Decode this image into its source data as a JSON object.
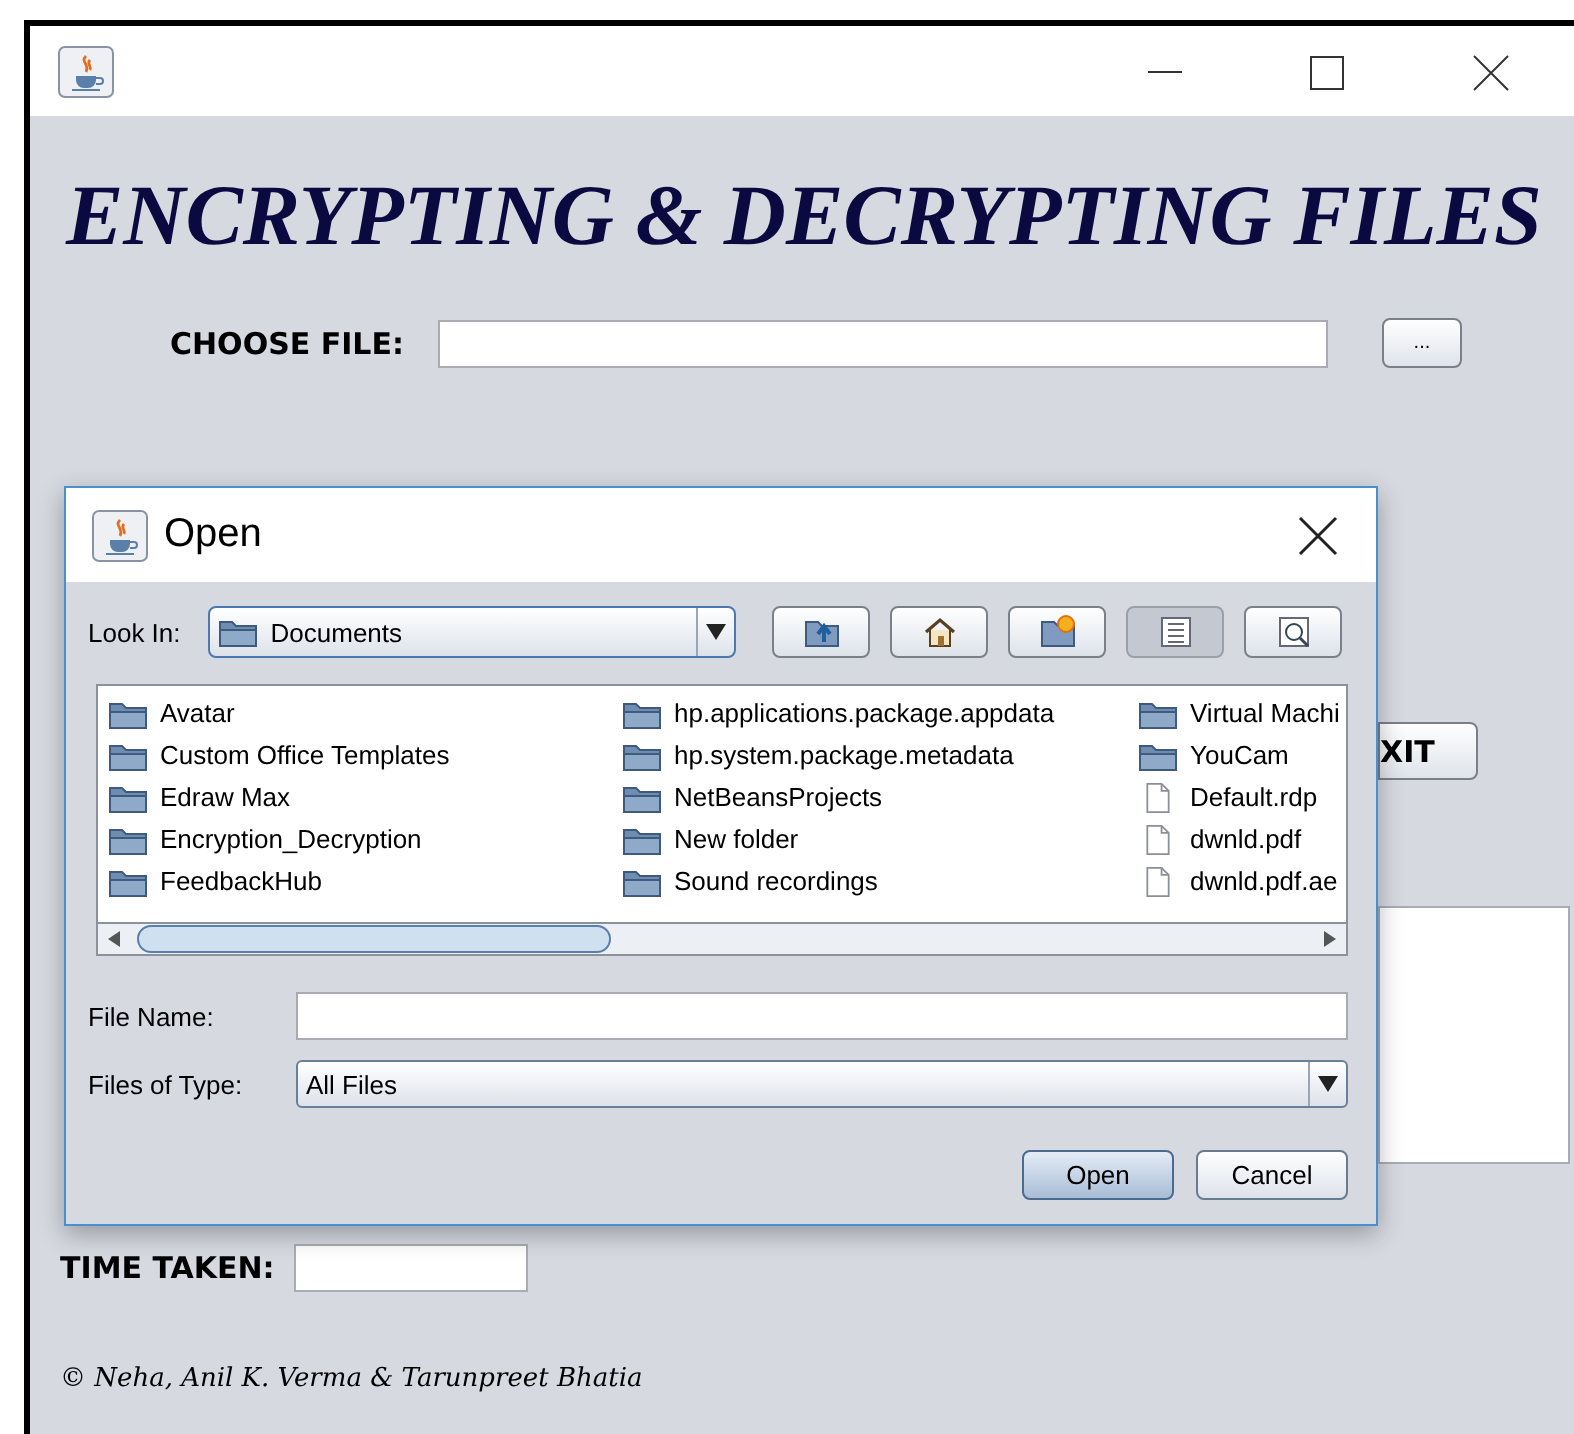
{
  "main_window": {
    "heading": "ENCRYPTING & DECRYPTING FILES",
    "choose_file": {
      "label": "CHOOSE FILE:",
      "browse_button": "..."
    },
    "exit_button": "XIT",
    "time_taken": {
      "label": "TIME TAKEN:"
    },
    "footer": "© Neha, Anil K. Verma & Tarunpreet Bhatia"
  },
  "dialog": {
    "title": "Open",
    "look_in": {
      "label": "Look In:",
      "value": "Documents"
    },
    "toolbar": [
      {
        "kind": "up",
        "selected": false
      },
      {
        "kind": "home",
        "selected": false
      },
      {
        "kind": "new-folder",
        "selected": false
      },
      {
        "kind": "list",
        "selected": true
      },
      {
        "kind": "details",
        "selected": false
      }
    ],
    "files": [
      {
        "name": "Avatar",
        "kind": "folder"
      },
      {
        "name": "Custom Office Templates",
        "kind": "folder"
      },
      {
        "name": "Edraw Max",
        "kind": "folder"
      },
      {
        "name": "Encryption_Decryption",
        "kind": "folder"
      },
      {
        "name": "FeedbackHub",
        "kind": "folder"
      },
      {
        "name": "hp.applications.package.appdata",
        "kind": "folder"
      },
      {
        "name": "hp.system.package.metadata",
        "kind": "folder"
      },
      {
        "name": "NetBeansProjects",
        "kind": "folder"
      },
      {
        "name": "New folder",
        "kind": "folder"
      },
      {
        "name": "Sound recordings",
        "kind": "folder"
      },
      {
        "name": "Virtual Machi",
        "kind": "folder"
      },
      {
        "name": "YouCam",
        "kind": "folder"
      },
      {
        "name": "Default.rdp",
        "kind": "file"
      },
      {
        "name": "dwnld.pdf",
        "kind": "file"
      },
      {
        "name": "dwnld.pdf.ae",
        "kind": "file"
      }
    ],
    "file_name": {
      "label": "File Name:"
    },
    "files_of_type": {
      "label": "Files of Type:",
      "value": "All Files"
    },
    "buttons": [
      "Open",
      "Cancel"
    ]
  }
}
